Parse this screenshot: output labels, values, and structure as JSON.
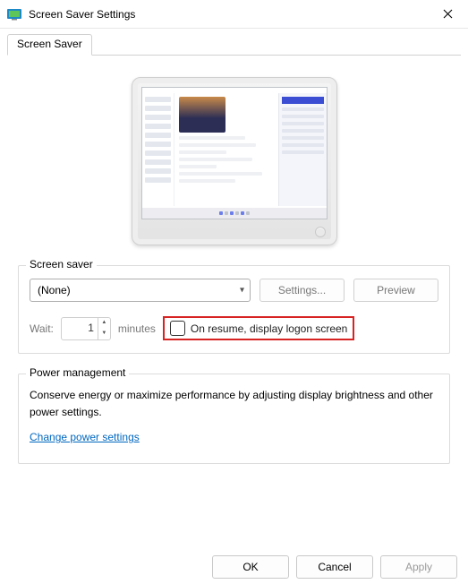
{
  "window": {
    "title": "Screen Saver Settings"
  },
  "tab": {
    "label": "Screen Saver"
  },
  "saver_group": {
    "title": "Screen saver",
    "dropdown_value": "(None)",
    "settings_btn": "Settings...",
    "preview_btn": "Preview",
    "wait_label": "Wait:",
    "wait_value": "1",
    "wait_unit": "minutes",
    "resume_label": "On resume, display logon screen"
  },
  "power_group": {
    "title": "Power management",
    "desc": "Conserve energy or maximize performance by adjusting display brightness and other power settings.",
    "link": "Change power settings"
  },
  "footer": {
    "ok": "OK",
    "cancel": "Cancel",
    "apply": "Apply"
  }
}
